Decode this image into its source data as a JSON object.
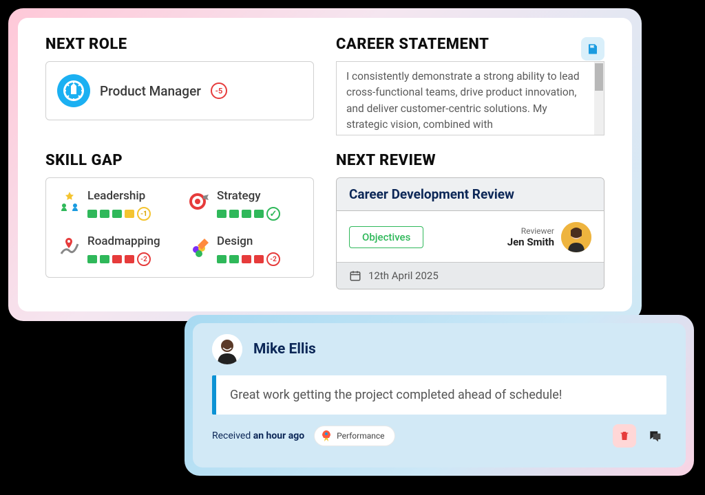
{
  "nextRole": {
    "heading": "NEXT ROLE",
    "title": "Product Manager",
    "delta": "-5"
  },
  "careerStatement": {
    "heading": "CAREER STATEMENT",
    "text": "I consistently demonstrate a strong ability to lead cross-functional teams, drive product innovation, and deliver customer-centric solutions. My strategic vision, combined with"
  },
  "skillGap": {
    "heading": "SKILL GAP",
    "skills": [
      {
        "name": "Leadership",
        "blocks": [
          "green",
          "green",
          "green",
          "yellow"
        ],
        "badge": "-1",
        "badgeType": "yellow"
      },
      {
        "name": "Strategy",
        "blocks": [
          "green",
          "green",
          "green",
          "green"
        ],
        "badge": "✓",
        "badgeType": "green-check"
      },
      {
        "name": "Roadmapping",
        "blocks": [
          "green",
          "green",
          "red",
          "red"
        ],
        "badge": "-2",
        "badgeType": "red"
      },
      {
        "name": "Design",
        "blocks": [
          "green",
          "green",
          "red",
          "red"
        ],
        "badge": "-2",
        "badgeType": "red"
      }
    ]
  },
  "nextReview": {
    "heading": "NEXT REVIEW",
    "title": "Career Development Review",
    "objectivesLabel": "Objectives",
    "reviewerLabel": "Reviewer",
    "reviewerName": "Jen Smith",
    "date": "12th April 2025"
  },
  "feedback": {
    "author": "Mike Ellis",
    "message": "Great work getting the project completed ahead of schedule!",
    "receivedPrefix": "Received ",
    "receivedTime": "an hour ago",
    "tag": "Performance"
  }
}
